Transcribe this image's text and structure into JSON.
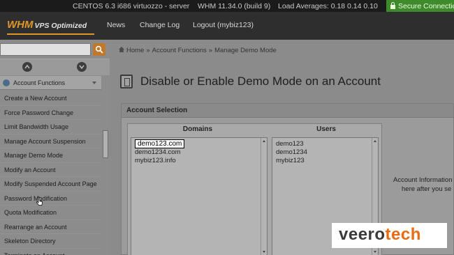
{
  "statusbar": {
    "os": "CENTOS 6.3 i686 virtuozzo - server",
    "whm_version": "WHM 11.34.0 (build 9)",
    "load": "Load Averages: 0.18 0.14 0.10",
    "secure": "Secure Connection"
  },
  "header": {
    "logo_main": "WHM",
    "logo_sub": "VPS Optimized",
    "nav": [
      "News",
      "Change Log",
      "Logout (mybiz123)"
    ]
  },
  "sidebar": {
    "section_label": "Account Functions",
    "items": [
      "Create a New Account",
      "Force Password Change",
      "Limit Bandwidth Usage",
      "Manage Account Suspension",
      "Manage Demo Mode",
      "Modify an Account",
      "Modify Suspended Account Page",
      "Password Modification",
      "Quota Modification",
      "Rearrange an Account",
      "Skeleton Directory",
      "Terminate an Account"
    ]
  },
  "breadcrumb": {
    "home": "Home",
    "level1": "Account Functions",
    "level2": "Manage Demo Mode",
    "sep": "»"
  },
  "page": {
    "title": "Disable or Enable Demo Mode on an Account"
  },
  "panel": {
    "title": "Account Selection",
    "domains_header": "Domains",
    "users_header": "Users",
    "domains": [
      "demo123.com",
      "demo1234.com",
      "mybiz123.info"
    ],
    "users": [
      "demo123",
      "demo1234",
      "mybiz123"
    ],
    "account_info_line1": "Account Information",
    "account_info_line2": "here after you se"
  },
  "watermark": {
    "part1": "veero",
    "part2": "tech"
  },
  "colors": {
    "accent": "#e0962a",
    "secure_green": "#3f8a2b",
    "watermark_orange": "#ea6a12"
  }
}
